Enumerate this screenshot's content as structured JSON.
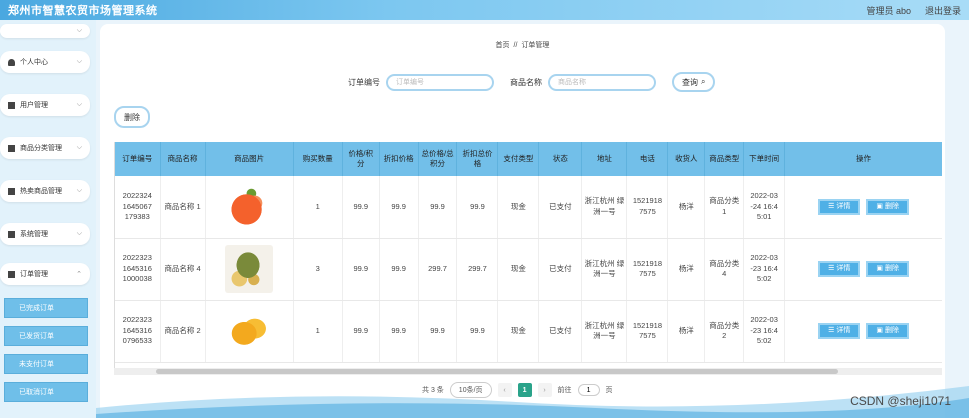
{
  "header": {
    "title": "郑州市智慧农贸市场管理系统",
    "user": "管理员 abo",
    "logout": "退出登录"
  },
  "sidebar": {
    "items": [
      {
        "label": "个人中心"
      },
      {
        "label": "用户管理"
      },
      {
        "label": "商品分类管理"
      },
      {
        "label": "热卖商品管理"
      },
      {
        "label": "系统管理"
      },
      {
        "label": "订单管理"
      }
    ],
    "sub_items": [
      {
        "label": "已完成订单"
      },
      {
        "label": "已发货订单"
      },
      {
        "label": "未支付订单"
      },
      {
        "label": "已取消订单"
      }
    ]
  },
  "breadcrumb": {
    "home": "首页",
    "sep": "//",
    "current": "订单管理"
  },
  "search": {
    "order_label": "订单编号",
    "order_placeholder": "订单编号",
    "product_label": "商品名称",
    "product_placeholder": "商品名称",
    "button": "查询"
  },
  "toolbar": {
    "delete_label": "删除"
  },
  "table": {
    "headers": [
      "订单编号",
      "商品名称",
      "商品图片",
      "购买数量",
      "价格/积分",
      "折扣价格",
      "总价格/总积分",
      "折扣总价格",
      "支付类型",
      "状态",
      "地址",
      "电话",
      "收货人",
      "商品类型",
      "下单时间",
      "操作"
    ],
    "rows": [
      {
        "order_no": "2022324 1645067 179383",
        "name": "商品名称 1",
        "qty": "1",
        "price": "99.9",
        "discount": "99.9",
        "total": "99.9",
        "discount_total": "99.9",
        "pay": "现金",
        "status": "已支付",
        "address": "浙江杭州 绿洲一号",
        "phone": "1521918 7575",
        "receiver": "杨洋",
        "type": "商品分类 1",
        "time": "2022-03 -24 16:4 5:01"
      },
      {
        "order_no": "2022323 1645316 1000038",
        "name": "商品名称 4",
        "qty": "3",
        "price": "99.9",
        "discount": "99.9",
        "total": "299.7",
        "discount_total": "299.7",
        "pay": "现金",
        "status": "已支付",
        "address": "浙江杭州 绿洲一号",
        "phone": "1521918 7575",
        "receiver": "杨洋",
        "type": "商品分类 4",
        "time": "2022-03 -23 16:4 5:02"
      },
      {
        "order_no": "2022323 1645316 0796533",
        "name": "商品名称 2",
        "qty": "1",
        "price": "99.9",
        "discount": "99.9",
        "total": "99.9",
        "discount_total": "99.9",
        "pay": "现金",
        "status": "已支付",
        "address": "浙江杭州 绿洲一号",
        "phone": "1521918 7575",
        "receiver": "杨洋",
        "type": "商品分类 2",
        "time": "2022-03 -23 16:4 5:02"
      }
    ],
    "detail_label": "详情",
    "delete_label": "删除"
  },
  "pager": {
    "total": "共 3 条",
    "size": "10条/页",
    "current": "1",
    "goto": "前往",
    "goto_value": "1",
    "page_unit": "页"
  },
  "watermark": "CSDN @sheji1071"
}
